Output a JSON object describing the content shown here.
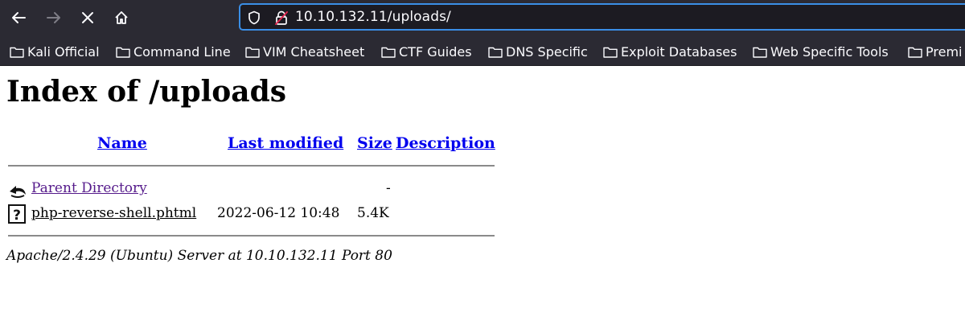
{
  "browser": {
    "url": "10.10.132.11/uploads/",
    "bookmarks": [
      "Kali Official",
      "Command Line",
      "VIM Cheatsheet",
      "CTF Guides",
      "DNS Specific",
      "Exploit Databases",
      "Web Specific Tools",
      "Premi"
    ],
    "accent_color": "#3a8ee6"
  },
  "page": {
    "title": "Index of /uploads",
    "columns": {
      "name": "Name",
      "last_modified": "Last modified",
      "size": "Size",
      "description": "Description"
    },
    "rows": [
      {
        "icon": "back-icon",
        "name": "Parent Directory",
        "last_modified": "",
        "size": "-",
        "description": ""
      },
      {
        "icon": "unknown-file-icon",
        "name": "php-reverse-shell.phtml",
        "last_modified": "2022-06-12 10:48",
        "size": "5.4K",
        "description": ""
      }
    ],
    "server_signature": "Apache/2.4.29 (Ubuntu) Server at 10.10.132.11 Port 80"
  }
}
